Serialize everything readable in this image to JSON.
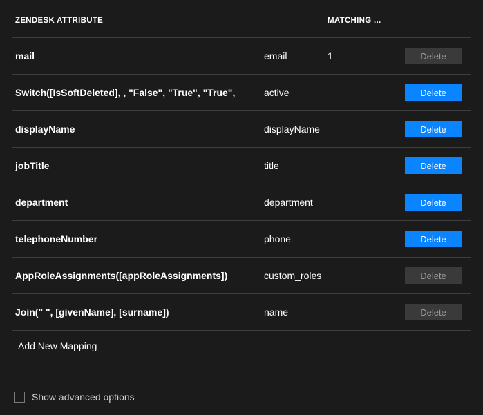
{
  "headers": {
    "source": "ZENDESK ATTRIBUTE",
    "target": "",
    "match": "MATCHING ..."
  },
  "rows": [
    {
      "source": "mail",
      "target": "email",
      "match": "1",
      "delete_label": "Delete",
      "delete_enabled": false
    },
    {
      "source": "Switch([IsSoftDeleted], , \"False\", \"True\", \"True\",",
      "target": "active",
      "match": "",
      "delete_label": "Delete",
      "delete_enabled": true
    },
    {
      "source": "displayName",
      "target": "displayName",
      "match": "",
      "delete_label": "Delete",
      "delete_enabled": true
    },
    {
      "source": "jobTitle",
      "target": "title",
      "match": "",
      "delete_label": "Delete",
      "delete_enabled": true
    },
    {
      "source": "department",
      "target": "department",
      "match": "",
      "delete_label": "Delete",
      "delete_enabled": true
    },
    {
      "source": "telephoneNumber",
      "target": "phone",
      "match": "",
      "delete_label": "Delete",
      "delete_enabled": true
    },
    {
      "source": "AppRoleAssignments([appRoleAssignments])",
      "target": "custom_roles",
      "match": "",
      "delete_label": "Delete",
      "delete_enabled": false
    },
    {
      "source": "Join(\" \", [givenName], [surname])",
      "target": "name",
      "match": "",
      "delete_label": "Delete",
      "delete_enabled": false
    }
  ],
  "add_mapping_label": "Add New Mapping",
  "show_advanced_label": "Show advanced options"
}
